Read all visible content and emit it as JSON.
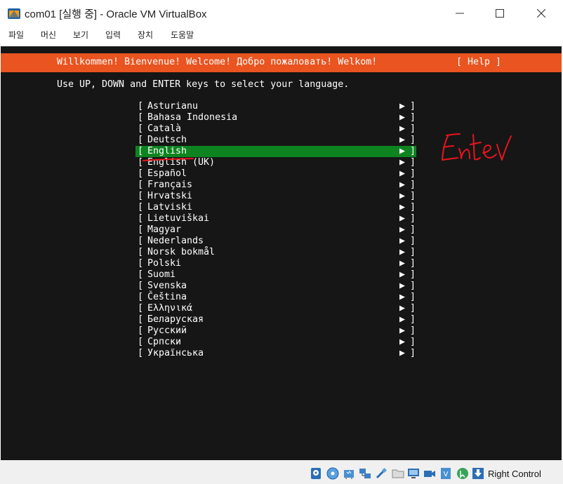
{
  "window": {
    "title": "com01 [실행 중] - Oracle VM VirtualBox",
    "icon": "virtualbox-app-icon",
    "controls": [
      "minimize-icon",
      "maximize-icon",
      "close-icon"
    ]
  },
  "menu": {
    "items": [
      "파일",
      "머신",
      "보기",
      "입력",
      "장치",
      "도움말"
    ]
  },
  "installer": {
    "welcome": "Willkommen! Bienvenue! Welcome! Добро пожаловать! Welkom!",
    "help": "[ Help ]",
    "instructions": "Use UP, DOWN and ENTER keys to select your language.",
    "bracket_open": "[",
    "bracket_close": "]",
    "arrow": "▶",
    "selected_index": 4,
    "languages": [
      "Asturianu",
      "Bahasa Indonesia",
      "Català",
      "Deutsch",
      "English",
      "English (UK)",
      "Español",
      "Français",
      "Hrvatski",
      "Latviski",
      "Lietuviškai",
      "Magyar",
      "Nederlands",
      "Norsk bokmål",
      "Polski",
      "Suomi",
      "Svenska",
      "Čeština",
      "Ελληνικά",
      "Беларуская",
      "Русский",
      "Српски",
      "Українська"
    ]
  },
  "annotation": {
    "handwritten": "Enter",
    "color": "#e8141e"
  },
  "colors": {
    "accent": "#e95420",
    "selection": "#0e8420",
    "screen_bg": "#161616"
  },
  "status_bar": {
    "icons": [
      "hard-disk-icon",
      "optical-disk-icon",
      "audio-icon",
      "network-icon",
      "usb-icon",
      "shared-folder-icon",
      "display-icon",
      "recording-icon",
      "virtualization-icon",
      "mouse-integration-icon",
      "keyboard-capture-icon"
    ],
    "host_key": "Right Control"
  }
}
